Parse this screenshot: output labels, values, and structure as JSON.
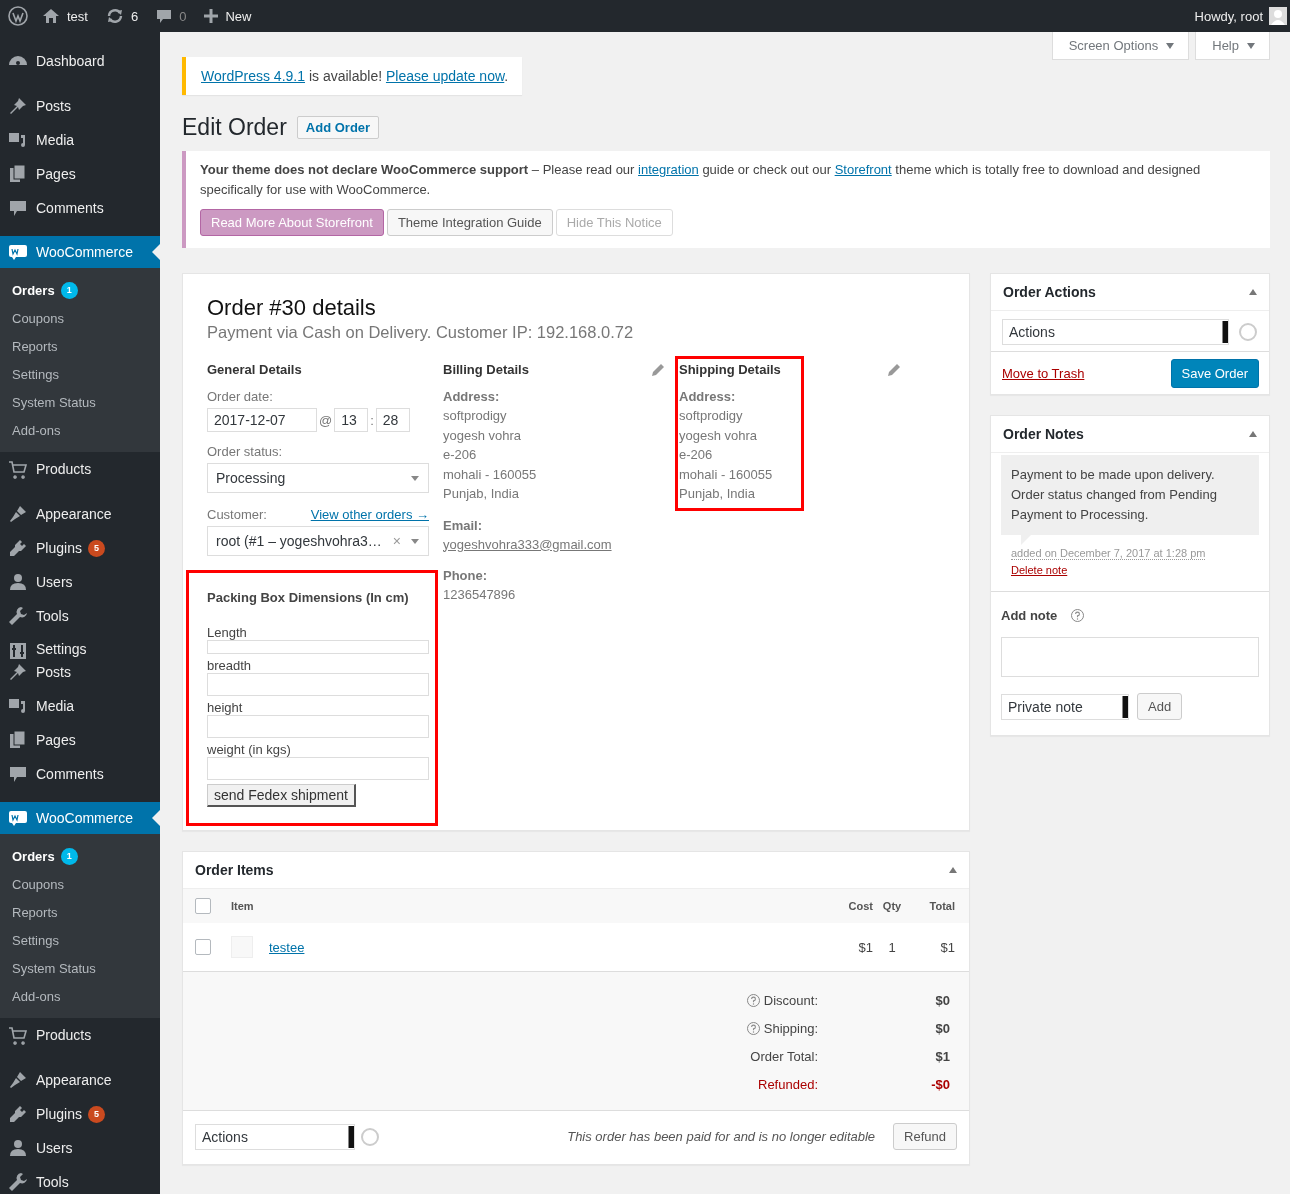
{
  "admin_bar": {
    "site": "test",
    "updates": "6",
    "comments": "0",
    "new": "New",
    "greeting": "Howdy, root"
  },
  "sidebar": [
    {
      "label": "Dashboard",
      "kind": "item"
    },
    {
      "label": "Posts",
      "kind": "item"
    },
    {
      "label": "Media",
      "kind": "item"
    },
    {
      "label": "Pages",
      "kind": "item"
    },
    {
      "label": "Comments",
      "kind": "item"
    },
    {
      "label": "WooCommerce",
      "kind": "current",
      "children": [
        {
          "label": "Orders",
          "selected": true,
          "badge": "1"
        },
        {
          "label": "Coupons",
          "selected": false
        },
        {
          "label": "Reports",
          "selected": false
        },
        {
          "label": "Settings",
          "selected": false
        },
        {
          "label": "System Status",
          "selected": false
        },
        {
          "label": "Add-ons",
          "selected": false
        }
      ]
    },
    {
      "label": "Products",
      "kind": "item"
    },
    {
      "label": "Appearance",
      "kind": "item"
    },
    {
      "label": "Plugins",
      "kind": "item",
      "badge": "5"
    },
    {
      "label": "Users",
      "kind": "item"
    },
    {
      "label": "Tools",
      "kind": "item"
    },
    {
      "label": "Settings",
      "kind": "item"
    },
    {
      "label": "Posts",
      "kind": "item"
    },
    {
      "label": "Media",
      "kind": "item"
    },
    {
      "label": "Pages",
      "kind": "item"
    },
    {
      "label": "Comments",
      "kind": "item"
    },
    {
      "label": "WooCommerce",
      "kind": "current",
      "children": [
        {
          "label": "Orders",
          "selected": true,
          "badge": "1"
        },
        {
          "label": "Coupons",
          "selected": false
        },
        {
          "label": "Reports",
          "selected": false
        },
        {
          "label": "Settings",
          "selected": false
        },
        {
          "label": "System Status",
          "selected": false
        },
        {
          "label": "Add-ons",
          "selected": false
        }
      ]
    },
    {
      "label": "Products",
      "kind": "item"
    },
    {
      "label": "Appearance",
      "kind": "item"
    },
    {
      "label": "Plugins",
      "kind": "item",
      "badge": "5"
    },
    {
      "label": "Users",
      "kind": "item"
    },
    {
      "label": "Tools",
      "kind": "item"
    }
  ],
  "screen_tabs": [
    "Screen Options",
    "Help"
  ],
  "update_notice": [
    {
      "kind": "link",
      "text": "WordPress 4.9.1"
    },
    {
      "kind": "text",
      "text": " is available! "
    },
    {
      "kind": "link",
      "text": "Please update now"
    },
    {
      "kind": "text",
      "text": "."
    }
  ],
  "page": {
    "title": "Edit Order",
    "add_button": "Add Order"
  },
  "theme_notice": {
    "segments": [
      {
        "kind": "text",
        "text": "**Your theme does not declare WooCommerce support** – Please read our "
      },
      {
        "kind": "link",
        "text": "integration"
      },
      {
        "kind": "text",
        "text": " guide or check out our "
      },
      {
        "kind": "link",
        "text": "Storefront"
      },
      {
        "kind": "text",
        "text": " theme which is totally free to download and designed specifically for use with WooCommerce."
      }
    ],
    "buttons": [
      {
        "label": "Read More About Storefront",
        "kind": "primary"
      },
      {
        "label": "Theme Integration Guide",
        "kind": "default"
      },
      {
        "label": "Hide This Notice",
        "kind": "muted"
      }
    ]
  },
  "order": {
    "title": "Order #30 details",
    "subtitle": "Payment via Cash on Delivery. Customer IP: 192.168.0.72",
    "general": {
      "heading": "General Details",
      "date_label": "Order date:",
      "date": "2017-12-07",
      "at": "@",
      "hour": "13",
      "sep": ":",
      "minute": "28",
      "status_label": "Order status:",
      "status": "Processing",
      "customer_label": "Customer:",
      "customer_link": "View other orders →",
      "customer": "root (#1 – yogeshvohra3…",
      "clear": "×"
    },
    "billing": {
      "heading": "Billing Details",
      "address_label": "Address:",
      "address": [
        "softprodigy",
        "yogesh vohra",
        "e-206",
        "mohali - 160055",
        "Punjab, India"
      ],
      "email_label": "Email:",
      "email": "yogeshvohra333@gmail.com",
      "phone_label": "Phone:",
      "phone": "1236547896"
    },
    "shipping": {
      "heading": "Shipping Details",
      "address_label": "Address:",
      "address": [
        "softprodigy",
        "yogesh vohra",
        "e-206",
        "mohali - 160055",
        "Punjab, India"
      ]
    },
    "packing": {
      "title": "Packing Box Dimensions (In cm)",
      "fields": [
        "Length",
        "breadth",
        "height",
        "weight (in kgs)"
      ],
      "button": "send Fedex shipment"
    }
  },
  "items": {
    "title": "Order Items",
    "header_checked": false,
    "columns": {
      "item": "Item",
      "cost": "Cost",
      "qty": "Qty",
      "total": "Total"
    },
    "rows": [
      {
        "name": "testee",
        "cost": "$1",
        "qty": "1",
        "total": "$1",
        "checked": false
      }
    ],
    "totals": [
      {
        "label": "Discount:",
        "value": "$0",
        "help": true,
        "kind": "normal"
      },
      {
        "label": "Shipping:",
        "value": "$0",
        "help": true,
        "kind": "normal"
      },
      {
        "label": "Order Total:",
        "value": "$1",
        "help": false,
        "kind": "normal"
      },
      {
        "label": "Refunded:",
        "value": "-$0",
        "help": false,
        "kind": "refund"
      }
    ],
    "actions": "Actions",
    "notice": "This order has been paid for and is no longer editable",
    "refund": "Refund"
  },
  "order_actions": {
    "title": "Order Actions",
    "select": "Actions",
    "trash": "Move to Trash",
    "save": "Save Order"
  },
  "order_notes": {
    "title": "Order Notes",
    "note": "Payment to be made upon delivery. Order status changed from Pending Payment to Processing.",
    "meta": "added on December 7, 2017 at 1:28 pm",
    "delete": "Delete note",
    "add_label": "Add note",
    "note_type": "Private note",
    "add": "Add"
  }
}
